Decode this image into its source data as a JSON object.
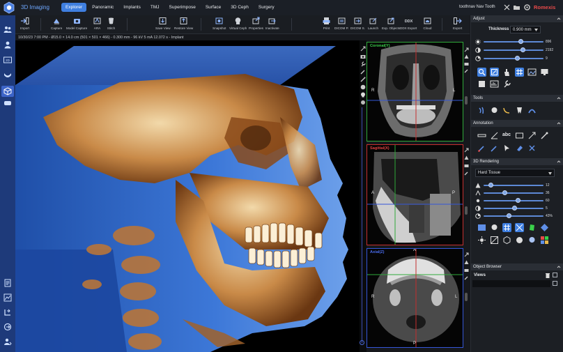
{
  "app": {
    "title": "3D Imaging",
    "brand": "Romexis",
    "patient": "toothnav Nav Tooth"
  },
  "tabs": [
    {
      "label": "Explorer",
      "active": true
    },
    {
      "label": "Panoramic"
    },
    {
      "label": "Implants"
    },
    {
      "label": "TMJ"
    },
    {
      "label": "Superimpose"
    },
    {
      "label": "Surface"
    },
    {
      "label": "3D Ceph"
    },
    {
      "label": "Surgery"
    }
  ],
  "toolbar": {
    "import": "Import",
    "capture": "Capture",
    "model_capture": "Model Capture",
    "ara": "ARA",
    "stitch": "Stitch",
    "save_view": "Save View",
    "restore_view": "Restore View",
    "snapshot": "Snapshot",
    "virtual_ceph": "Virtual Ceph",
    "properties": "Properties",
    "inactivate": "Inactivate",
    "print": "Print",
    "dicom_p": "DICOM P.",
    "dicom_s": "DICOM S.",
    "launch": "Launch",
    "exp_objects": "Exp. Objects",
    "ddx_export": "DDX Export",
    "cloud": "Cloud",
    "export": "Export",
    "ddx_badge": "DDX"
  },
  "info_line": "10/30/23 7:00 PM - Ø15.0 × 14.0 cm (501 × 501 × 466) - 0.300 mm - 96 kV 5 mA 12.072 s - Implant",
  "mpr": {
    "coronal": {
      "title": "Coronal(Y)",
      "left": "R",
      "right": "L"
    },
    "sagittal": {
      "title": "Sagittal(X)",
      "left": "A",
      "right": "P"
    },
    "axial": {
      "title": "Axial(Z)",
      "top": "A",
      "bottom": "P",
      "left": "R",
      "right": "L"
    }
  },
  "adjust": {
    "header": "Adjust",
    "thickness_label": "Thickness",
    "thickness_value": "0.900 mm",
    "sliders": [
      {
        "icon": "brightness-icon",
        "value": "896",
        "level": 0.62
      },
      {
        "icon": "contrast-icon",
        "value": "2192",
        "level": 0.66
      },
      {
        "icon": "gamma-icon",
        "value": "9",
        "level": 0.56
      }
    ]
  },
  "tools": {
    "header": "Tools"
  },
  "annotation": {
    "header": "Annotation",
    "abc": "abc"
  },
  "rendering": {
    "header": "3D Rendering",
    "preset": "Hard Tissue",
    "sliders": [
      {
        "icon": "threshold-icon",
        "value": "12",
        "level": 0.12
      },
      {
        "icon": "window-icon",
        "value": "36",
        "level": 0.36
      },
      {
        "icon": "brightness-icon",
        "value": "60",
        "level": 0.58
      },
      {
        "icon": "contrast-icon",
        "value": "5",
        "level": 0.52
      },
      {
        "icon": "opacity-icon",
        "value": "43%",
        "level": 0.42
      }
    ]
  },
  "object_browser": {
    "header": "Object Browser",
    "views_label": "Views"
  },
  "colors": {
    "accent": "#3f7fe0",
    "sidebar": "#1e3a7a",
    "brand": "#e84a4a",
    "coronal": "#2faa3a",
    "sagittal": "#c52e2e",
    "axial": "#3456d8"
  }
}
